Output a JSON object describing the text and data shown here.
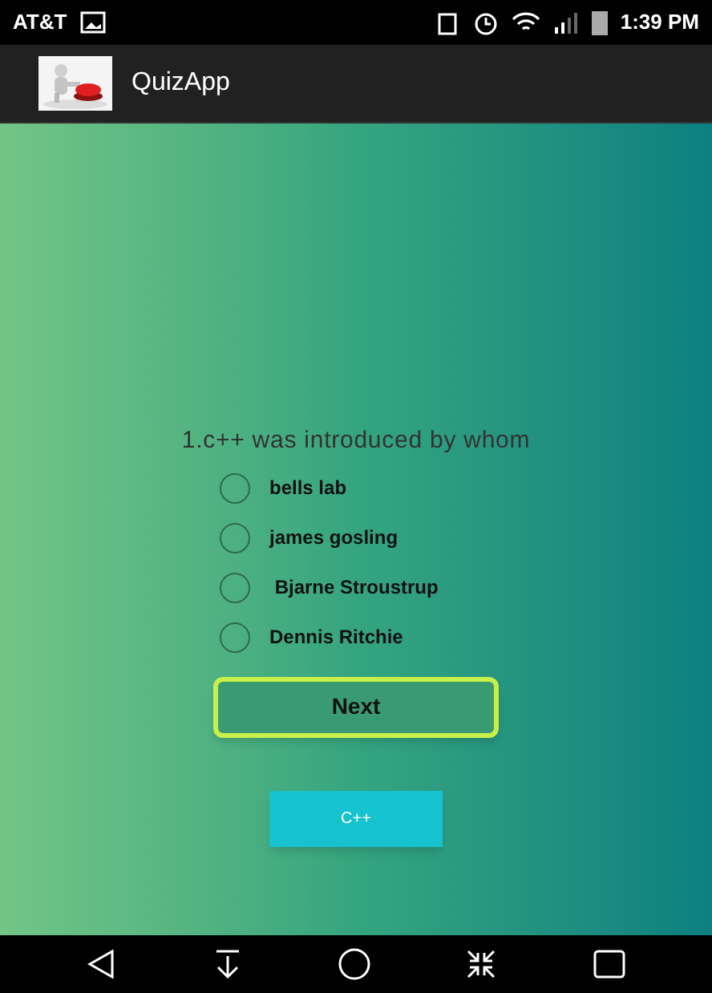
{
  "status_bar": {
    "carrier": "AT&T",
    "time": "1:39 PM"
  },
  "app_bar": {
    "title": "QuizApp"
  },
  "question": "1.c++ was introduced by whom",
  "options": [
    {
      "label": "bells lab",
      "selected": false
    },
    {
      "label": "james gosling",
      "selected": false
    },
    {
      "label": " Bjarne Stroustrup",
      "selected": false
    },
    {
      "label": "Dennis Ritchie",
      "selected": false
    }
  ],
  "next_button": "Next",
  "topic_button": "C++"
}
